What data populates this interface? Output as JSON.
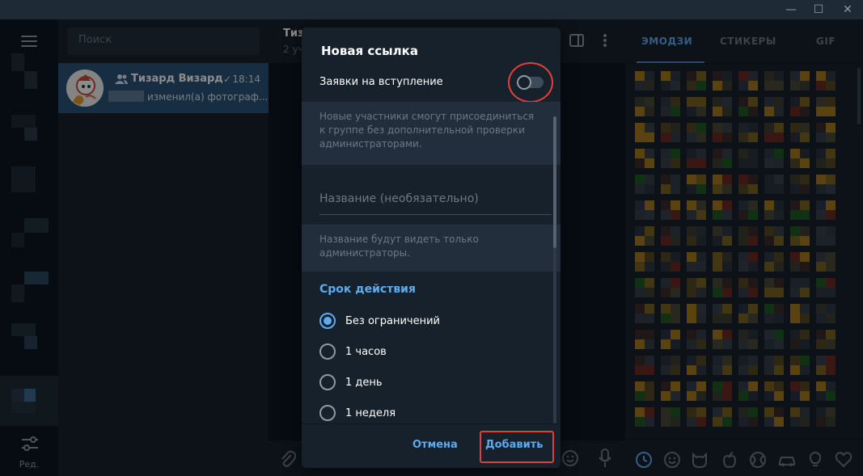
{
  "window": {
    "minimize_glyph": "—",
    "maximize_glyph": "☐",
    "close_glyph": "✕"
  },
  "rail": {
    "edit_label": "Ред."
  },
  "chat_list": {
    "search_placeholder": "Поиск",
    "items": [
      {
        "name": "Тизард Визард",
        "time": "18:14",
        "check": "✓",
        "preview": "изменил(а) фотограф..."
      }
    ]
  },
  "main": {
    "title": "Тиз",
    "subtitle": "2 уч"
  },
  "emoji_panel": {
    "tabs": [
      "ЭМОДЗИ",
      "СТИКЕРЫ",
      "GIF"
    ],
    "active_tab": "ЭМОДЗИ",
    "categories": [
      "recent-icon",
      "smile-icon",
      "cat-icon",
      "apple-icon",
      "ball-icon",
      "car-icon",
      "bulb-icon",
      "heart-icon"
    ]
  },
  "modal": {
    "title": "Новая ссылка",
    "join_requests_label": "Заявки на вступление",
    "join_requests_enabled": false,
    "join_requests_hint": "Новые участники смогут присоединиться к группе без дополнительной проверки администраторами.",
    "name_placeholder": "Название (необязательно)",
    "name_hint": "Название будут видеть только администраторы.",
    "expiry_title": "Срок действия",
    "expiry_options": [
      "Без ограничений",
      "1 часов",
      "1 день",
      "1 неделя"
    ],
    "expiry_selected": "Без ограничений",
    "cancel_label": "Отмена",
    "add_label": "Добавить"
  },
  "colors": {
    "accent": "#5eaaef",
    "highlight": "#e0403a",
    "selected_chat": "#2b5278"
  }
}
